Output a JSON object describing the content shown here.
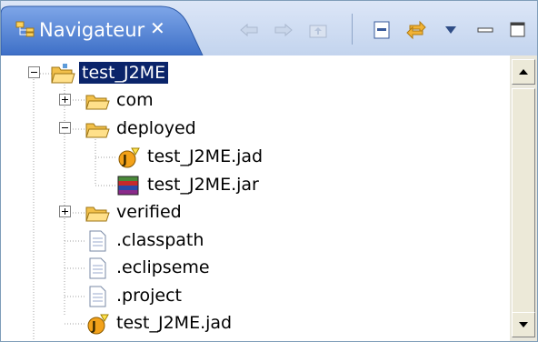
{
  "view": {
    "title": "Navigateur",
    "close_glyph": "✕",
    "toolbar": [
      {
        "name": "back-icon",
        "enabled": false
      },
      {
        "name": "forward-icon",
        "enabled": false
      },
      {
        "name": "up-folder-icon",
        "enabled": false
      },
      {
        "name": "collapse-all-icon",
        "enabled": true
      },
      {
        "name": "link-with-editor-icon",
        "enabled": true
      },
      {
        "name": "view-menu-icon",
        "enabled": true
      },
      {
        "name": "minimize-icon",
        "enabled": true
      },
      {
        "name": "maximize-icon",
        "enabled": true
      }
    ]
  },
  "tree": {
    "root": {
      "label": "test_J2ME",
      "icon": "open-project-folder-icon",
      "expanded": true,
      "selected": true
    },
    "items": [
      {
        "label": "com",
        "icon": "folder-icon",
        "expander": "plus"
      },
      {
        "label": "deployed",
        "icon": "open-folder-icon",
        "expander": "minus"
      },
      {
        "label": "test_J2ME.jad",
        "icon": "jad-file-icon",
        "expander": null
      },
      {
        "label": "test_J2ME.jar",
        "icon": "jar-archive-icon",
        "expander": null
      },
      {
        "label": "verified",
        "icon": "folder-icon",
        "expander": "plus"
      },
      {
        "label": ".classpath",
        "icon": "file-icon",
        "expander": null
      },
      {
        "label": ".eclipseme",
        "icon": "file-icon",
        "expander": null
      },
      {
        "label": ".project",
        "icon": "file-icon",
        "expander": null
      },
      {
        "label": "test_J2ME.jad",
        "icon": "jad-file-icon",
        "expander": null
      }
    ]
  },
  "colors": {
    "tab_active": "#5a86d6",
    "selection": "#0a246a",
    "folder": "#f2c04a",
    "window_border": "#7f9db9"
  }
}
